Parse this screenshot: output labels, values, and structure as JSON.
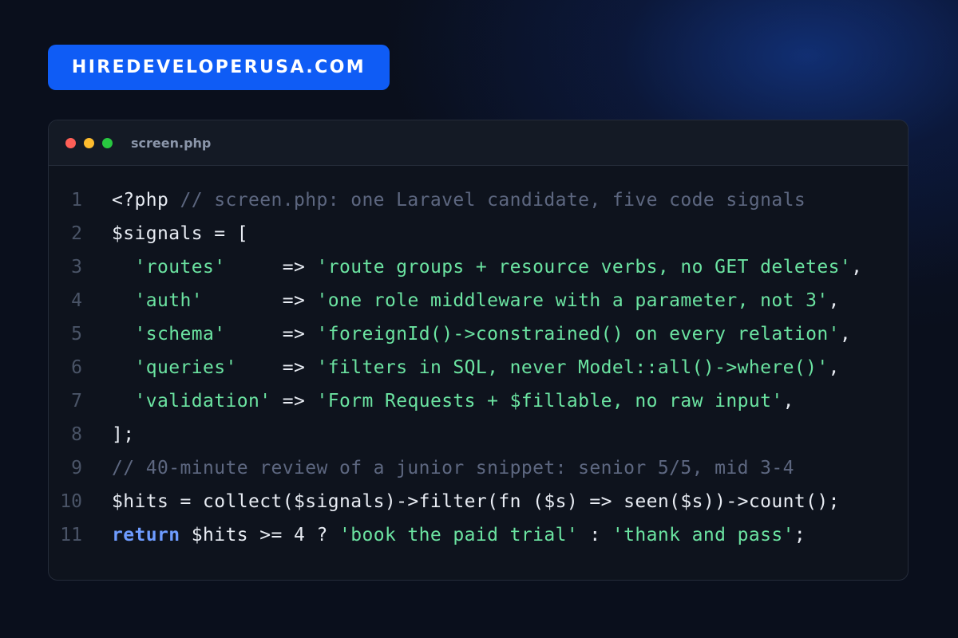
{
  "brand": {
    "label": "HIREDEVELOPERUSA.COM",
    "color": "#0f5cf5"
  },
  "window": {
    "file_name": "screen.php",
    "buttons": [
      "close",
      "minimize",
      "maximize"
    ]
  },
  "code": {
    "lines": [
      {
        "number": "1",
        "tokens": [
          {
            "type": "plain",
            "text": "<?php "
          },
          {
            "type": "comment",
            "text": "// screen.php: one Laravel candidate, five code signals"
          }
        ]
      },
      {
        "number": "2",
        "tokens": [
          {
            "type": "plain",
            "text": "$signals = ["
          }
        ]
      },
      {
        "number": "3",
        "tokens": [
          {
            "type": "plain",
            "text": "  "
          },
          {
            "type": "string",
            "text": "'routes'"
          },
          {
            "type": "plain",
            "text": "     => "
          },
          {
            "type": "string",
            "text": "'route groups + resource verbs, no GET deletes'"
          },
          {
            "type": "plain",
            "text": ","
          }
        ]
      },
      {
        "number": "4",
        "tokens": [
          {
            "type": "plain",
            "text": "  "
          },
          {
            "type": "string",
            "text": "'auth'"
          },
          {
            "type": "plain",
            "text": "       => "
          },
          {
            "type": "string",
            "text": "'one role middleware with a parameter, not 3'"
          },
          {
            "type": "plain",
            "text": ","
          }
        ]
      },
      {
        "number": "5",
        "tokens": [
          {
            "type": "plain",
            "text": "  "
          },
          {
            "type": "string",
            "text": "'schema'"
          },
          {
            "type": "plain",
            "text": "     => "
          },
          {
            "type": "string",
            "text": "'foreignId()->constrained() on every relation'"
          },
          {
            "type": "plain",
            "text": ","
          }
        ]
      },
      {
        "number": "6",
        "tokens": [
          {
            "type": "plain",
            "text": "  "
          },
          {
            "type": "string",
            "text": "'queries'"
          },
          {
            "type": "plain",
            "text": "    => "
          },
          {
            "type": "string",
            "text": "'filters in SQL, never Model::all()->where()'"
          },
          {
            "type": "plain",
            "text": ","
          }
        ]
      },
      {
        "number": "7",
        "tokens": [
          {
            "type": "plain",
            "text": "  "
          },
          {
            "type": "string",
            "text": "'validation'"
          },
          {
            "type": "plain",
            "text": " => "
          },
          {
            "type": "string",
            "text": "'Form Requests + $fillable, no raw input'"
          },
          {
            "type": "plain",
            "text": ","
          }
        ]
      },
      {
        "number": "8",
        "tokens": [
          {
            "type": "plain",
            "text": "];"
          }
        ]
      },
      {
        "number": "9",
        "tokens": [
          {
            "type": "comment",
            "text": "// 40-minute review of a junior snippet: senior 5/5, mid 3-4"
          }
        ]
      },
      {
        "number": "10",
        "tokens": [
          {
            "type": "plain",
            "text": "$hits = collect($signals)->filter(fn ($s) => seen($s))->count();"
          }
        ]
      },
      {
        "number": "11",
        "tokens": [
          {
            "type": "keyword",
            "text": "return"
          },
          {
            "type": "plain",
            "text": " $hits >= 4 ? "
          },
          {
            "type": "string",
            "text": "'book the paid trial'"
          },
          {
            "type": "plain",
            "text": " : "
          },
          {
            "type": "string",
            "text": "'thank and pass'"
          },
          {
            "type": "plain",
            "text": ";"
          }
        ]
      }
    ]
  },
  "colors": {
    "background": "#0a0f1c",
    "editor_background": "#0e131d",
    "plain": "#e8ecf3",
    "comment": "#5d6780",
    "string": "#6be3a1",
    "keyword": "#6e9cff",
    "line_number": "#4a5467"
  }
}
